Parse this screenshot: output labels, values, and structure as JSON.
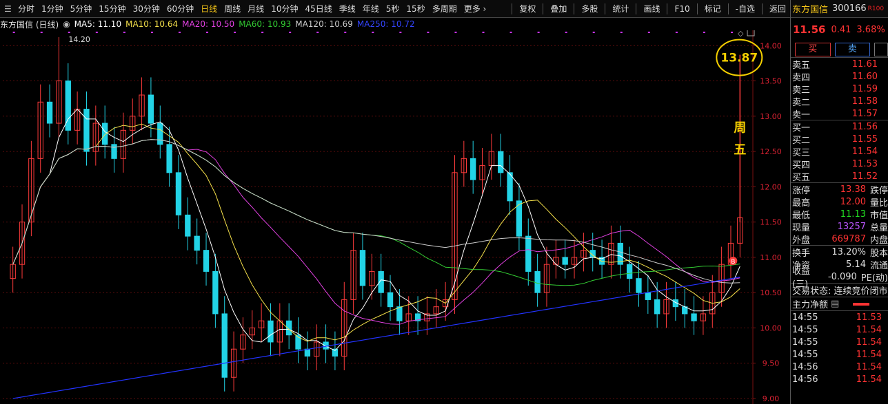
{
  "toolbar": {
    "periods": [
      "分时",
      "1分钟",
      "5分钟",
      "15分钟",
      "30分钟",
      "60分钟",
      "日线",
      "周线",
      "月线",
      "10分钟",
      "45日线",
      "季线",
      "年线",
      "5秒",
      "15秒",
      "多周期",
      "更多 ›"
    ],
    "active_period": "日线",
    "tools": [
      "复权",
      "叠加",
      "多股",
      "统计",
      "画线",
      "F10",
      "标记",
      "-自选",
      "返回"
    ]
  },
  "legend": {
    "title": "东方国信 (日线)",
    "ma5": "MA5: 11.10",
    "ma10": "MA10: 10.64",
    "ma20": "MA20: 10.50",
    "ma60": "MA60: 10.93",
    "ma120": "MA120: 10.69",
    "ma250": "MA250: 10.72"
  },
  "colors": {
    "up": "#ff3b3b",
    "down": "#22d3e6",
    "ma5": "#ffffff",
    "ma10": "#f5e04a",
    "ma20": "#e040e0",
    "ma60": "#33cc33",
    "ma120": "#cccccc",
    "ma250": "#2233ff",
    "annotation": "#f5d000"
  },
  "chart_data": {
    "type": "candlestick",
    "ylim": [
      9.0,
      14.1
    ],
    "yticks": [
      "14.00",
      "13.50",
      "13.00",
      "12.50",
      "12.00",
      "11.50",
      "11.00",
      "10.50",
      "10.00",
      "9.50",
      "9.00"
    ],
    "high_label": "14.20",
    "circle_label": "13.87",
    "friday_label": "周五",
    "trade_marker": "B",
    "series_close_approx": [
      10.9,
      11.5,
      12.4,
      13.2,
      12.9,
      13.5,
      12.8,
      13.1,
      12.5,
      12.9,
      12.6,
      12.4,
      12.8,
      13.0,
      13.3,
      12.9,
      12.6,
      12.2,
      11.6,
      11.3,
      11.1,
      10.8,
      10.2,
      9.3,
      9.7,
      9.9,
      10.0,
      10.1,
      9.8,
      10.1,
      9.9,
      9.7,
      9.6,
      9.8,
      9.7,
      9.6,
      10.4,
      11.1,
      10.6,
      10.8,
      10.5,
      10.3,
      10.1,
      10.2,
      10.1,
      10.2,
      10.3,
      10.4,
      12.2,
      12.4,
      12.1,
      12.3,
      12.5,
      12.2,
      11.8,
      11.3,
      10.8,
      10.5,
      10.9,
      11.0,
      10.9,
      11.0,
      11.1,
      11.0,
      10.9,
      11.2,
      10.9,
      10.7,
      10.5,
      10.4,
      10.2,
      10.4,
      10.3,
      10.2,
      10.1,
      10.2,
      10.5,
      10.9,
      11.2,
      11.56
    ]
  },
  "quote": {
    "name": "东方国信",
    "code": "300166",
    "tag": "R100",
    "price": "11.56",
    "change": "0.41",
    "change_pct": "3.68%",
    "buy_label": "买",
    "sell_label": "卖",
    "asks": [
      {
        "label": "卖五",
        "price": "11.61"
      },
      {
        "label": "卖四",
        "price": "11.60"
      },
      {
        "label": "卖三",
        "price": "11.59"
      },
      {
        "label": "卖二",
        "price": "11.58"
      },
      {
        "label": "卖一",
        "price": "11.57"
      }
    ],
    "bids": [
      {
        "label": "买一",
        "price": "11.56"
      },
      {
        "label": "买二",
        "price": "11.55"
      },
      {
        "label": "买三",
        "price": "11.54"
      },
      {
        "label": "买四",
        "price": "11.53"
      },
      {
        "label": "买五",
        "price": "11.52"
      }
    ],
    "stats": [
      {
        "label": "涨停",
        "value": "13.38",
        "extra": "跌停"
      },
      {
        "label": "最高",
        "value": "12.00",
        "extra": "量比"
      },
      {
        "label": "最低",
        "value": "11.13",
        "extra": "市值"
      },
      {
        "label": "现量",
        "value": "13257",
        "extra": "总量"
      },
      {
        "label": "外盘",
        "value": "669787",
        "extra": "内盘"
      }
    ],
    "stats2": [
      {
        "label": "换手",
        "value": "13.20%",
        "extra": "股本"
      },
      {
        "label": "净资",
        "value": "5.14",
        "extra": "流通"
      },
      {
        "label": "收益(三)",
        "value": "-0.090",
        "extra": "PE(动)"
      }
    ],
    "status": "交易状态: 连续竞价闭市",
    "flow_label": "主力净额",
    "ticks": [
      {
        "time": "14:55",
        "price": "11.53"
      },
      {
        "time": "14:55",
        "price": "11.54"
      },
      {
        "time": "14:55",
        "price": "11.54"
      },
      {
        "time": "14:55",
        "price": "11.54"
      },
      {
        "time": "14:56",
        "price": "11.54"
      },
      {
        "time": "14:56",
        "price": "11.54"
      }
    ]
  }
}
